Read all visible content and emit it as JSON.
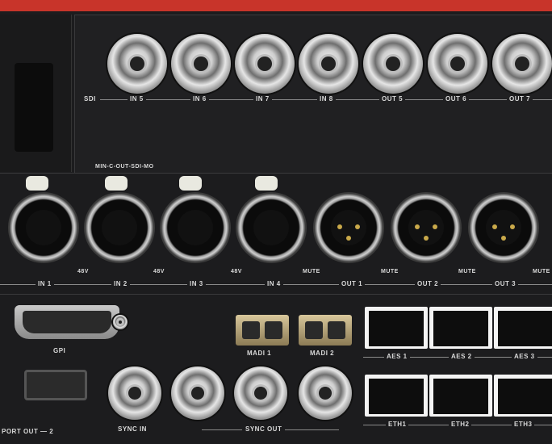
{
  "sdi": {
    "group_label": "SDI",
    "in5": "IN 5",
    "in6": "IN 6",
    "in7": "IN 7",
    "in8": "IN 8",
    "out5": "OUT 5",
    "out6": "OUT 6",
    "out7": "OUT 7"
  },
  "model_label": "MIN-C-OUT-SDI-MO",
  "mic": {
    "in1": "IN 1",
    "in2": "IN 2",
    "in3": "IN 3",
    "in4": "IN 4",
    "phantom1": "48V",
    "phantom2": "48V",
    "phantom3": "48V",
    "mute_out1": "MUTE",
    "mute_out2": "MUTE",
    "mute_out3": "MUTE",
    "mute_out4": "MUTE",
    "out1": "OUT 1",
    "out2": "OUT 2",
    "out3": "OUT 3"
  },
  "gpi_label": "GPI",
  "fiber": {
    "port1": "MADI 1",
    "port2": "MADI 2"
  },
  "aes": {
    "a1": "AES 1",
    "a2": "AES 2",
    "a3": "AES 3"
  },
  "eth": {
    "e1": "ETH1",
    "e2": "ETH2",
    "e3": "ETH3"
  },
  "sync": {
    "in": "SYNC IN",
    "out": "SYNC OUT"
  },
  "port_out_label": "PORT OUT — 2",
  "colors": {
    "panel": "#1c1c1e",
    "accent_red": "#c8342a",
    "label": "#d9d9d9"
  }
}
